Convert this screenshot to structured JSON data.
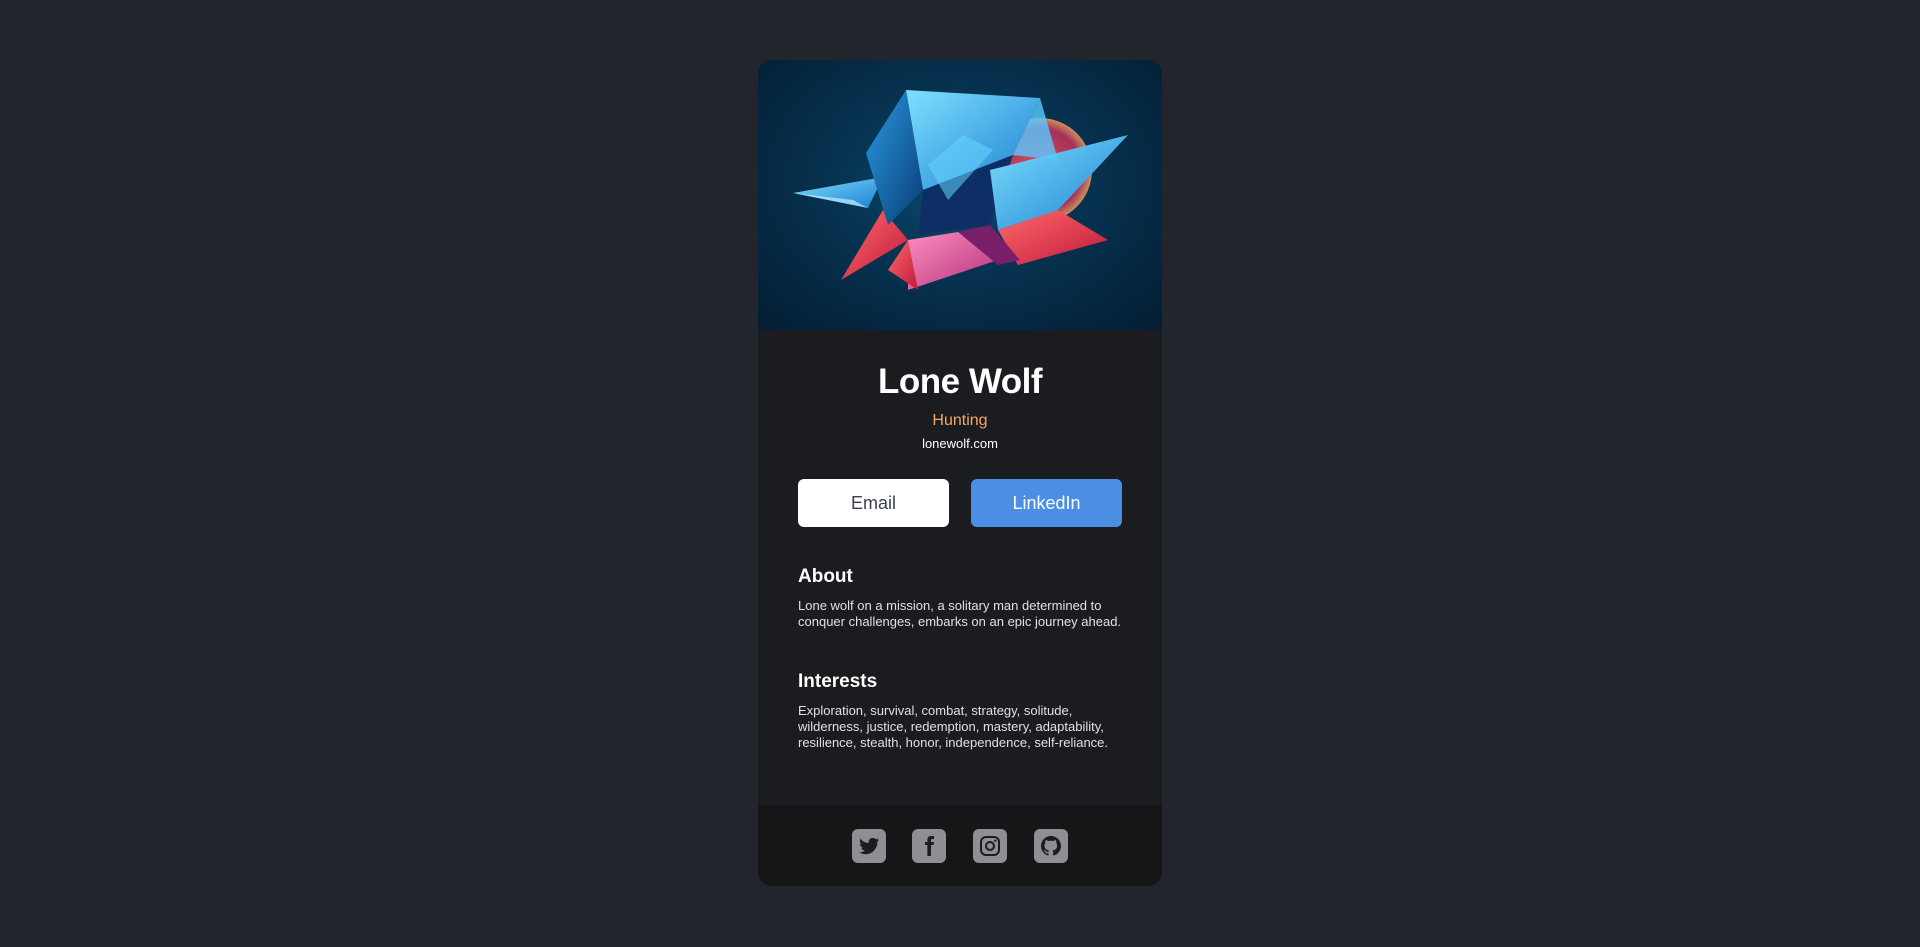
{
  "profile": {
    "name": "Lone Wolf",
    "role": "Hunting",
    "website": "lonewolf.com"
  },
  "actions": {
    "email_label": "Email",
    "linkedin_label": "LinkedIn"
  },
  "about": {
    "heading": "About",
    "text": "Lone wolf on a mission, a solitary man determined to conquer challenges, embarks on an epic jour­ney ahead."
  },
  "interests": {
    "heading": "Interests",
    "text": "Exploration, survival, combat, strategy, solitude, wilderness, justice, redemption, mastery, adapt­ability, resilience, stealth, honor, independence, self-reliance."
  },
  "social": [
    {
      "icon": "twitter-icon"
    },
    {
      "icon": "facebook-icon"
    },
    {
      "icon": "instagram-icon"
    },
    {
      "icon": "github-icon"
    }
  ],
  "colors": {
    "page_background": "#23252d",
    "card_background": "#1b1c20",
    "footer_background": "#161619",
    "role_accent": "#f3a56a",
    "linkedin_button": "#4a8fe3",
    "email_button": "#ffffff",
    "social_icon_bg": "#8e8e93"
  }
}
